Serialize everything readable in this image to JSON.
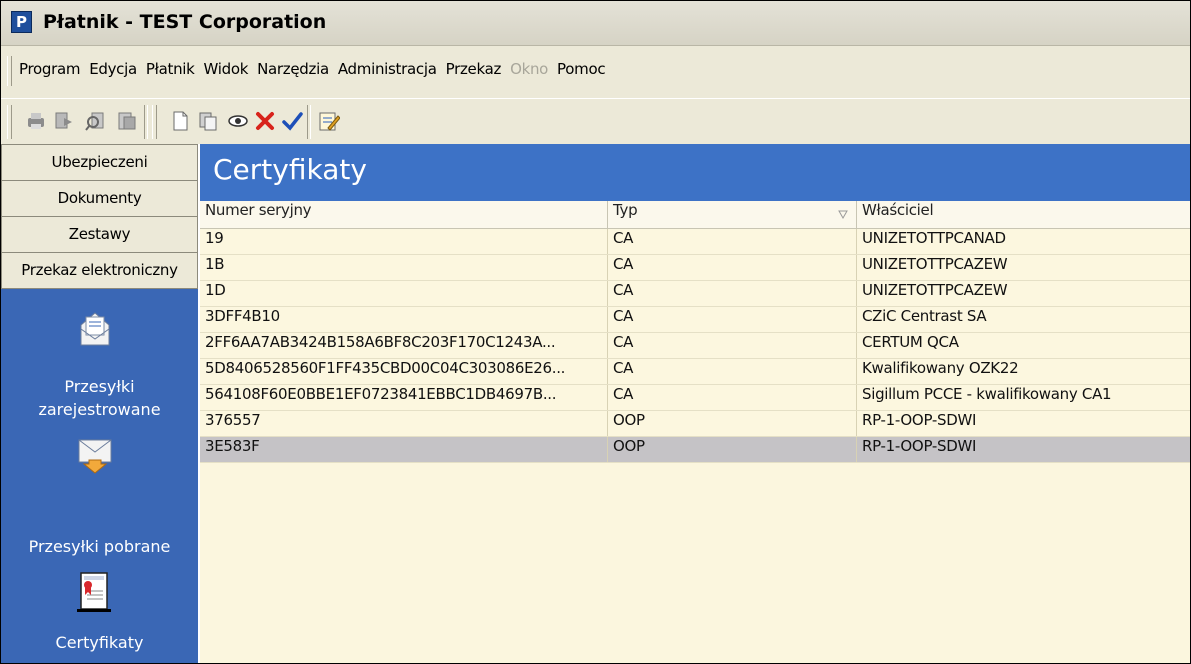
{
  "window": {
    "title": "Płatnik - TEST Corporation"
  },
  "menu": [
    {
      "label": "Program",
      "enabled": true
    },
    {
      "label": "Edycja",
      "enabled": true
    },
    {
      "label": "Płatnik",
      "enabled": true
    },
    {
      "label": "Widok",
      "enabled": true
    },
    {
      "label": "Narzędzia",
      "enabled": true
    },
    {
      "label": "Administracja",
      "enabled": true
    },
    {
      "label": "Przekaz",
      "enabled": true
    },
    {
      "label": "Okno",
      "enabled": false
    },
    {
      "label": "Pomoc",
      "enabled": true
    }
  ],
  "toolbar": {
    "buttons": [
      "print-icon",
      "export-icon",
      "find-icon",
      "preview-icon",
      "new-document-icon",
      "copy-icon",
      "view-icon",
      "delete-icon",
      "confirm-icon",
      "edit-icon"
    ]
  },
  "nav": {
    "tabs": [
      "Ubezpieczeni",
      "Dokumenty",
      "Zestawy",
      "Przekaz elektroniczny"
    ],
    "items": [
      {
        "label_line1": "Przesyłki",
        "label_line2": "zarejestrowane",
        "icon": "registered-mail-icon"
      },
      {
        "label": "Przesyłki pobrane",
        "icon": "downloaded-mail-icon"
      },
      {
        "label": "Certyfikaty",
        "icon": "certificate-icon"
      }
    ]
  },
  "main": {
    "title": "Certyfikaty",
    "columns": [
      "Numer seryjny",
      "Typ",
      "Właściciel"
    ],
    "rows": [
      {
        "serial": "19",
        "type": "CA",
        "owner": "UNIZETOTTPCANAD"
      },
      {
        "serial": "1B",
        "type": "CA",
        "owner": "UNIZETOTTPCAZEW"
      },
      {
        "serial": "1D",
        "type": "CA",
        "owner": "UNIZETOTTPCAZEW"
      },
      {
        "serial": "3DFF4B10",
        "type": "CA",
        "owner": "CZiC Centrast SA"
      },
      {
        "serial": "2FF6AA7AB3424B158A6BF8C203F170C1243A...",
        "type": "CA",
        "owner": "CERTUM QCA"
      },
      {
        "serial": "5D8406528560F1FF435CBD00C04C303086E26...",
        "type": "CA",
        "owner": "Kwalifikowany OZK22"
      },
      {
        "serial": "564108F60E0BBE1EF0723841EBBC1DB4697B...",
        "type": "CA",
        "owner": "Sigillum PCCE - kwalifikowany CA1"
      },
      {
        "serial": "376557",
        "type": "OOP",
        "owner": "RP-1-OOP-SDWI"
      },
      {
        "serial": "3E583F",
        "type": "OOP",
        "owner": "RP-1-OOP-SDWI"
      }
    ],
    "selected_row": 8
  },
  "colors": {
    "nav_bg": "#3a67b5",
    "header_band": "#3d72c6",
    "grid_bg": "#fcf7df",
    "selected_row": "#c5c3c6"
  }
}
